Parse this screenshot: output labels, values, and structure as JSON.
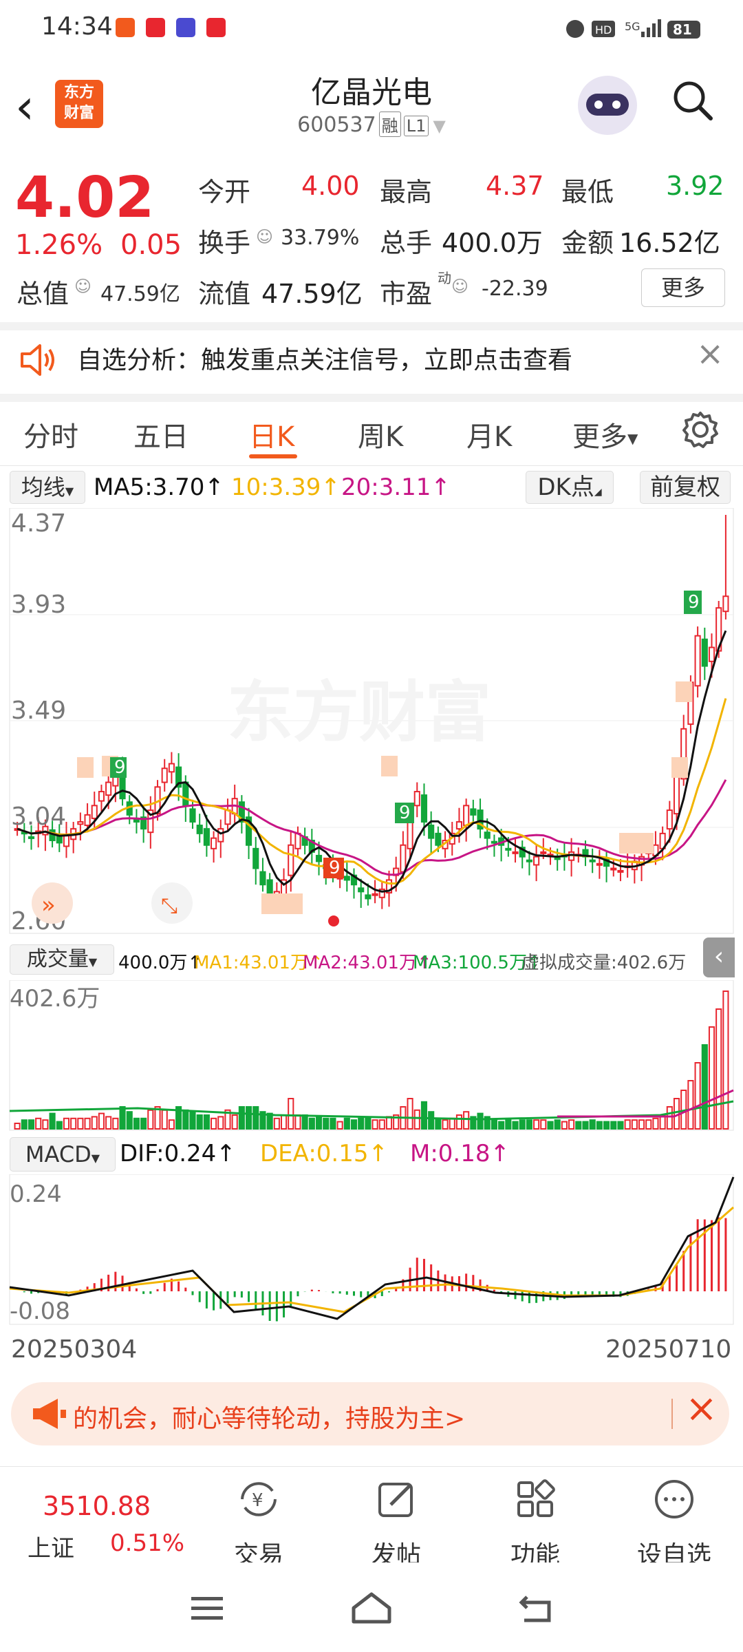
{
  "status_bar": {
    "time": "14:34",
    "battery": "81",
    "network": "5G",
    "hd": "HD"
  },
  "header": {
    "logo_line1": "东方",
    "logo_line2": "财富",
    "stock_name": "亿晶光电",
    "stock_code": "600537",
    "tag_rong": "融",
    "tag_level": "L1"
  },
  "quote": {
    "price": "4.02",
    "change_pct": "1.26%",
    "change_amt": "0.05",
    "open_label": "今开",
    "open": "4.00",
    "high_label": "最高",
    "high": "4.37",
    "low_label": "最低",
    "low": "3.92",
    "turnover_label": "换手",
    "turnover": "33.79%",
    "volume_label": "总手",
    "volume": "400.0万",
    "amount_label": "金额",
    "amount": "16.52亿",
    "mktcap_label": "总值",
    "mktcap": "47.59亿",
    "float_label": "流值",
    "float_cap": "47.59亿",
    "pe_label": "市盈",
    "pe_sup": "动",
    "pe": "-22.39",
    "more": "更多"
  },
  "alert": {
    "text": "自选分析：触发重点关注信号，立即点击查看"
  },
  "tabs": [
    "分时",
    "五日",
    "日K",
    "周K",
    "月K",
    "更多"
  ],
  "active_tab": "日K",
  "ma_bar": {
    "selector": "均线",
    "ma5": "MA5:3.70",
    "ma10": "10:3.39",
    "ma20": "20:3.11",
    "dk": "DK点",
    "adjust": "前复权"
  },
  "price_axis": [
    "4.37",
    "3.93",
    "3.49",
    "3.04",
    "2.60"
  ],
  "watermark": "东方财富",
  "volume_bar": {
    "selector": "成交量",
    "vol": "400.0万",
    "ma1": "MA1:43.01万",
    "ma2": "MA2:43.01万",
    "ma3": "MA3:100.5万",
    "virtual": "虚拟成交量:402.6万",
    "axis_max": "402.6万"
  },
  "macd_bar": {
    "selector": "MACD",
    "dif": "DIF:0.24",
    "dea": "DEA:0.15",
    "m": "M:0.18",
    "axis_top": "0.24",
    "axis_bottom": "-0.08"
  },
  "date_range": {
    "start": "20250304",
    "end": "20250710"
  },
  "banner": {
    "text": "的机会，耐心等待轮动，持股为主>"
  },
  "bottom_nav": {
    "index_value": "3510.88",
    "index_name": "上证",
    "index_change": "0.51%",
    "items": [
      "交易",
      "发帖",
      "功能",
      "设自选"
    ]
  },
  "colors": {
    "up": "#e8262f",
    "down": "#11a63a",
    "ma5": "#111111",
    "ma10": "#f2b400",
    "ma20": "#c71585",
    "accent": "#f25a1d"
  },
  "chart_data": {
    "type": "candlestick",
    "title": "",
    "ylim": [
      2.6,
      4.37
    ],
    "x_range": [
      "20250304",
      "20250710"
    ],
    "last_close": 4.02,
    "last_open": 4.0,
    "last_high": 4.37,
    "last_low": 3.92,
    "ma_latest": {
      "MA5": 3.7,
      "MA10": 3.39,
      "MA20": 3.11
    },
    "closes": [
      3.02,
      3.0,
      2.98,
      3.01,
      3.03,
      2.97,
      2.96,
      2.99,
      3.02,
      3.05,
      3.08,
      3.12,
      3.18,
      3.22,
      3.25,
      3.15,
      3.08,
      3.05,
      3.02,
      3.1,
      3.2,
      3.28,
      3.3,
      3.2,
      3.12,
      3.05,
      3.0,
      2.95,
      2.98,
      3.02,
      3.1,
      3.15,
      3.05,
      2.95,
      2.85,
      2.78,
      2.72,
      2.75,
      2.8,
      2.95,
      3.0,
      2.95,
      2.92,
      2.88,
      2.85,
      2.82,
      2.83,
      2.8,
      2.78,
      2.75,
      2.72,
      2.74,
      2.76,
      2.8,
      2.85,
      2.95,
      3.1,
      3.18,
      3.05,
      2.98,
      2.95,
      2.97,
      3.0,
      3.05,
      3.12,
      3.08,
      3.02,
      2.98,
      2.96,
      2.95,
      2.93,
      2.92,
      2.9,
      2.88,
      2.9,
      2.92,
      2.91,
      2.89,
      2.9,
      2.92,
      2.91,
      2.9,
      2.88,
      2.87,
      2.86,
      2.85,
      2.84,
      2.86,
      2.88,
      2.9,
      2.92,
      2.95,
      3.0,
      3.1,
      3.25,
      3.45,
      3.65,
      3.85,
      3.72,
      3.8,
      3.97,
      4.02
    ],
    "volume_max": "402.6万",
    "macd": {
      "DIF": 0.24,
      "DEA": 0.15,
      "M": 0.18,
      "ylim": [
        -0.08,
        0.24
      ]
    }
  }
}
